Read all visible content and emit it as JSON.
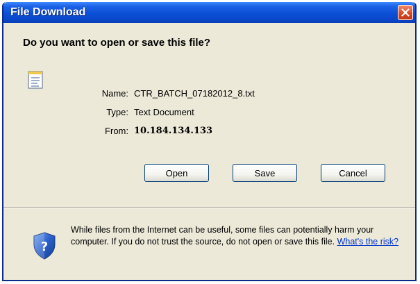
{
  "window": {
    "title": "File Download",
    "close_icon": "close-icon"
  },
  "prompt": {
    "question": "Do you want to open or save this file?"
  },
  "file": {
    "icon": "text-document-icon",
    "name_label": "Name:",
    "name_value": "CTR_BATCH_07182012_8.txt",
    "type_label": "Type:",
    "type_value": "Text Document",
    "from_label": "From:",
    "from_value": "10.184.134.133"
  },
  "buttons": {
    "open_label": "Open",
    "save_label": "Save",
    "cancel_label": "Cancel"
  },
  "warning": {
    "icon": "security-shield-question-icon",
    "text": "While files from the Internet can be useful, some files can potentially harm your computer. If you do not trust the source, do not open or save this file.",
    "link_text": "What's the risk?"
  },
  "colors": {
    "titlebar": "#0a4fd6",
    "dialog_bg": "#ece9d8",
    "close_button": "#d8451f",
    "link": "#0033cc"
  }
}
